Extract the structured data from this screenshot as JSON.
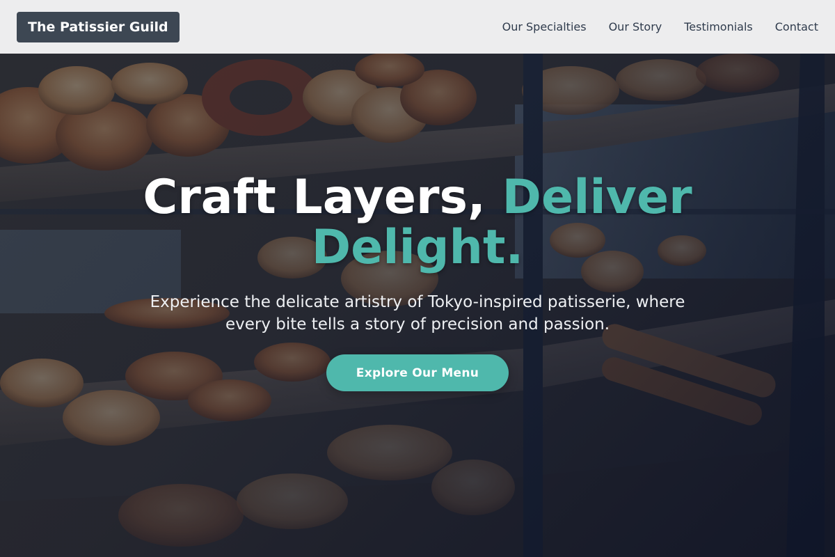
{
  "header": {
    "brand": "The Patissier Guild",
    "nav": [
      {
        "label": "Our Specialties"
      },
      {
        "label": "Our Story"
      },
      {
        "label": "Testimonials"
      },
      {
        "label": "Contact"
      }
    ]
  },
  "hero": {
    "headline_main": "Craft Layers, ",
    "headline_accent": "Deliver Delight.",
    "subtitle": "Experience the delicate artistry of Tokyo-inspired patisserie, where every bite tells a story of precision and passion.",
    "cta_label": "Explore Our Menu",
    "background_image": "bakery-display-case-photo"
  },
  "colors": {
    "accent": "#4fb8ac",
    "brand_bg": "#3d4753",
    "header_bg": "#f4f4f5",
    "nav_text": "#2f3b4c"
  }
}
